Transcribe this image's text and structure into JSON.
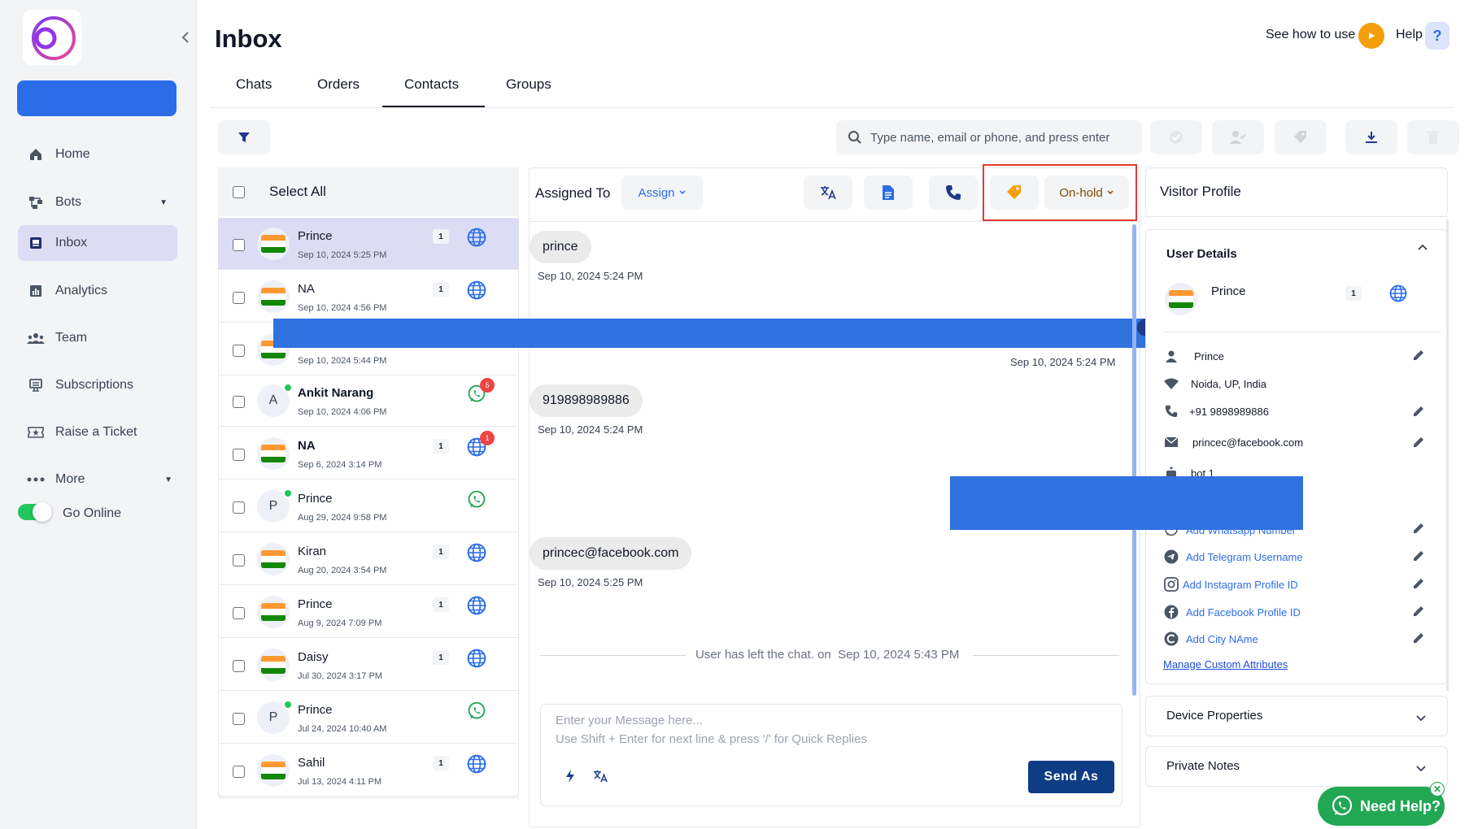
{
  "app": {
    "page_title": "Inbox",
    "see_how": "See how to use",
    "help": "Help",
    "help_icon": "?"
  },
  "sidebar": {
    "items": [
      {
        "label": "Home",
        "icon": "home-icon"
      },
      {
        "label": "Bots",
        "icon": "bots-icon"
      },
      {
        "label": "Inbox",
        "icon": "inbox-icon"
      },
      {
        "label": "Analytics",
        "icon": "analytics-icon"
      },
      {
        "label": "Team",
        "icon": "team-icon"
      },
      {
        "label": "Subscriptions",
        "icon": "subscriptions-icon"
      },
      {
        "label": "Raise a Ticket",
        "icon": "ticket-icon"
      },
      {
        "label": "More",
        "icon": "more-icon"
      }
    ],
    "go_online": "Go Online",
    "online": true
  },
  "tabs": [
    "Chats",
    "Orders",
    "Contacts",
    "Groups"
  ],
  "active_tab": "Contacts",
  "search": {
    "placeholder": "Type name, email or phone, and press enter"
  },
  "list": {
    "select_all": "Select All",
    "rows": [
      {
        "name": "Prince",
        "date": "Sep 10, 2024 5:25 PM",
        "count": "1",
        "channel": "web",
        "avatar": "flag"
      },
      {
        "name": "NA",
        "date": "Sep 10, 2024 4:56 PM",
        "count": "1",
        "channel": "web",
        "avatar": "flag"
      },
      {
        "name": "",
        "date": "Sep 10, 2024 5:44 PM",
        "count": "",
        "channel": "",
        "avatar": "flag"
      },
      {
        "name": "Ankit Narang",
        "date": "Sep 10, 2024 4:06 PM",
        "count": "",
        "channel": "whatsapp",
        "avatar": "A",
        "badge": "5"
      },
      {
        "name": "NA",
        "date": "Sep 6, 2024 3:14 PM",
        "count": "1",
        "channel": "web",
        "avatar": "flag",
        "badge": "1"
      },
      {
        "name": "Prince",
        "date": "Aug 29, 2024 9:58 PM",
        "count": "",
        "channel": "whatsapp",
        "avatar": "P"
      },
      {
        "name": "Kiran",
        "date": "Aug 20, 2024 3:54 PM",
        "count": "1",
        "channel": "web",
        "avatar": "flag"
      },
      {
        "name": "Prince",
        "date": "Aug 9, 2024 7:09 PM",
        "count": "1",
        "channel": "web",
        "avatar": "flag"
      },
      {
        "name": "Daisy",
        "date": "Jul 30, 2024 3:17 PM",
        "count": "1",
        "channel": "web",
        "avatar": "flag"
      },
      {
        "name": "Prince",
        "date": "Jul 24, 2024 10:40 AM",
        "count": "",
        "channel": "whatsapp",
        "avatar": "P"
      },
      {
        "name": "Sahil",
        "date": "Jul 13, 2024 4:11 PM",
        "count": "1",
        "channel": "web",
        "avatar": "flag"
      }
    ]
  },
  "chat": {
    "assigned_to": "Assigned To",
    "assign": "Assign",
    "status": "On-hold",
    "messages": [
      {
        "text": "prince",
        "date": "Sep 10, 2024 5:24 PM"
      },
      {
        "text": "",
        "date": "Sep 10, 2024 5:24 PM"
      },
      {
        "text": "919898989886",
        "date": "Sep 10, 2024 5:24 PM"
      },
      {
        "text": "princec@facebook.com",
        "date": "Sep 10, 2024 5:25 PM"
      }
    ],
    "system_msg": "User has left the chat. on",
    "system_date": "Sep 10, 2024 5:43 PM",
    "composer_line1": "Enter your Message here...",
    "composer_line2": "Use Shift + Enter for next line & press '/' for Quick Replies",
    "send_as": "Send As"
  },
  "profile": {
    "title": "Visitor Profile",
    "user_details": "User Details",
    "name": "Prince",
    "count": "1",
    "fields": {
      "name": "Prince",
      "location": "Noida, UP, India",
      "phone": "+91 9898989886",
      "email": "princec@facebook.com",
      "bot": "bot 1"
    },
    "links": [
      "Add Whatsapp Number",
      "Add Telegram Username",
      "Add Instagram Profile ID",
      "Add Facebook Profile ID",
      "Add City NAme"
    ],
    "manage": "Manage Custom Attributes",
    "device_properties": "Device Properties",
    "private_notes": "Private Notes"
  },
  "need_help": "Need Help?",
  "colors": {
    "accent": "#2b6de9",
    "send": "#0f3d85",
    "tag": "#f59e0b",
    "online": "#22c55e",
    "highlight_box": "#e53935"
  }
}
